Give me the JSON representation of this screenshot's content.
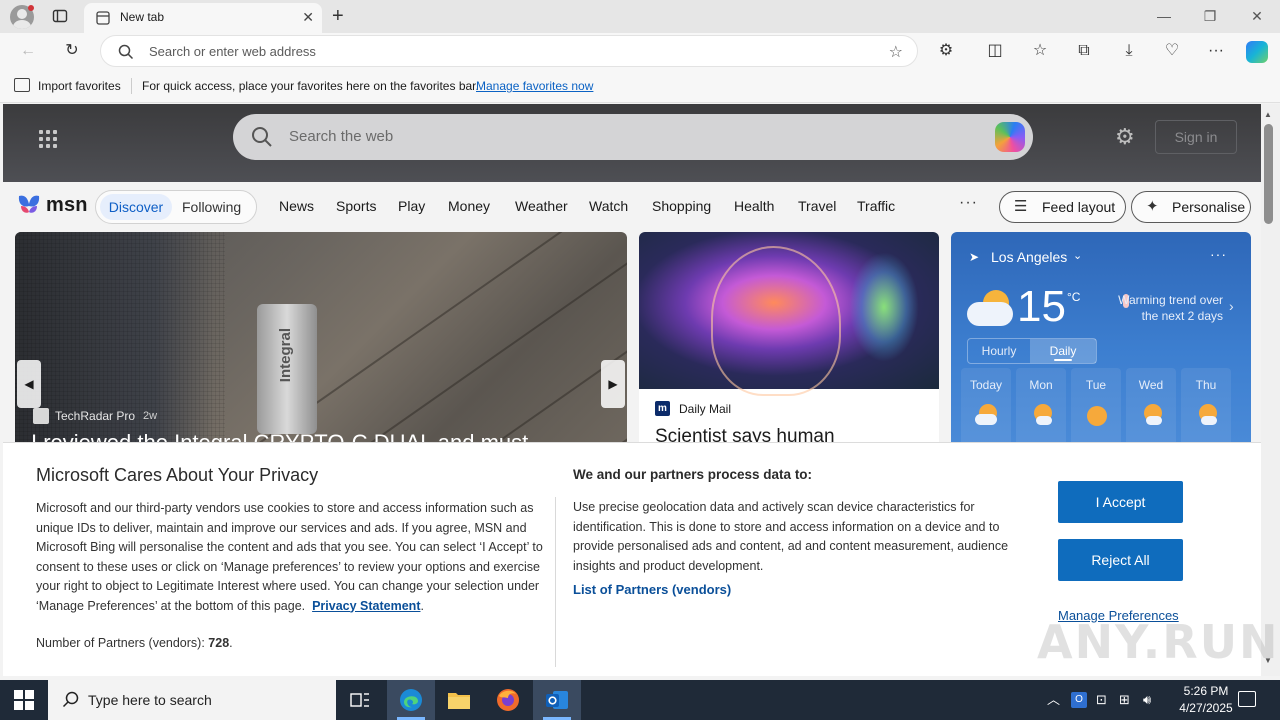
{
  "browser": {
    "tab_title": "New tab",
    "address_placeholder": "Search or enter web address"
  },
  "favorites_bar": {
    "import_label": "Import favorites",
    "hint_text": "For quick access, place your favorites here on the favorites bar.",
    "manage_link": "Manage favorites now"
  },
  "msn": {
    "search_placeholder": "Search the web",
    "sign_in": "Sign in",
    "logo_text": "msn",
    "feed_toggle": [
      "Discover",
      "Following"
    ],
    "nav_items": [
      "News",
      "Sports",
      "Play",
      "Money",
      "Weather",
      "Watch",
      "Shopping",
      "Health",
      "Travel",
      "Traffic"
    ],
    "more": "···",
    "feed_layout": "Feed layout",
    "personalise": "Personalise"
  },
  "hero": {
    "source": "TechRadar Pro",
    "age": "2w",
    "title": "I reviewed the Integral CRYPTO-C DUAL and must",
    "device_label": "Integral"
  },
  "card2": {
    "source_icon": "m",
    "source": "Daily Mail",
    "title": "Scientist says human"
  },
  "weather": {
    "location": "Los Angeles",
    "temperature": "15",
    "unit": "°C",
    "trend": "Warming trend over the next 2 days",
    "tabs": [
      "Hourly",
      "Daily"
    ],
    "days": [
      {
        "name": "Today",
        "icon": "partly-cloudy-icon"
      },
      {
        "name": "Mon",
        "icon": "partly-sunny-icon"
      },
      {
        "name": "Tue",
        "icon": "sunny-icon"
      },
      {
        "name": "Wed",
        "icon": "partly-sunny-icon"
      },
      {
        "name": "Thu",
        "icon": "partly-sunny-icon"
      }
    ]
  },
  "privacy": {
    "title": "Microsoft Cares About Your Privacy",
    "body": "Microsoft and our third-party vendors use cookies to store and access information such as unique IDs to deliver, maintain and improve our services and ads. If you agree, MSN and Microsoft Bing will personalise the content and ads that you see. You can select ‘I Accept’ to consent to these uses or click on ‘Manage preferences’ to review your options and exercise your right to object to Legitimate Interest where used.  You can change your selection under ‘Manage Preferences’ at the bottom of this page.",
    "privacy_link": "Privacy Statement",
    "partners_label": "Number of Partners (vendors):",
    "partners_count": "728",
    "process_title": "We and our partners process data to:",
    "process_body": "Use precise geolocation data and actively scan device characteristics for identification. This is done to store and access information on a device and to provide personalised ads and content, ad and content measurement, audience insights and product development.",
    "partners_link": "List of Partners (vendors)",
    "accept": "I Accept",
    "reject": "Reject All",
    "manage": "Manage Preferences"
  },
  "watermark": "ANY.RUN",
  "taskbar": {
    "search_placeholder": "Type here to search",
    "time": "5:26 PM",
    "date": "4/27/2025"
  },
  "colors": {
    "accent_blue": "#0f6cbd",
    "link_blue": "#0a4f99",
    "weather_bg": "#3d7fd0",
    "taskbar_bg": "#1f2a38"
  }
}
